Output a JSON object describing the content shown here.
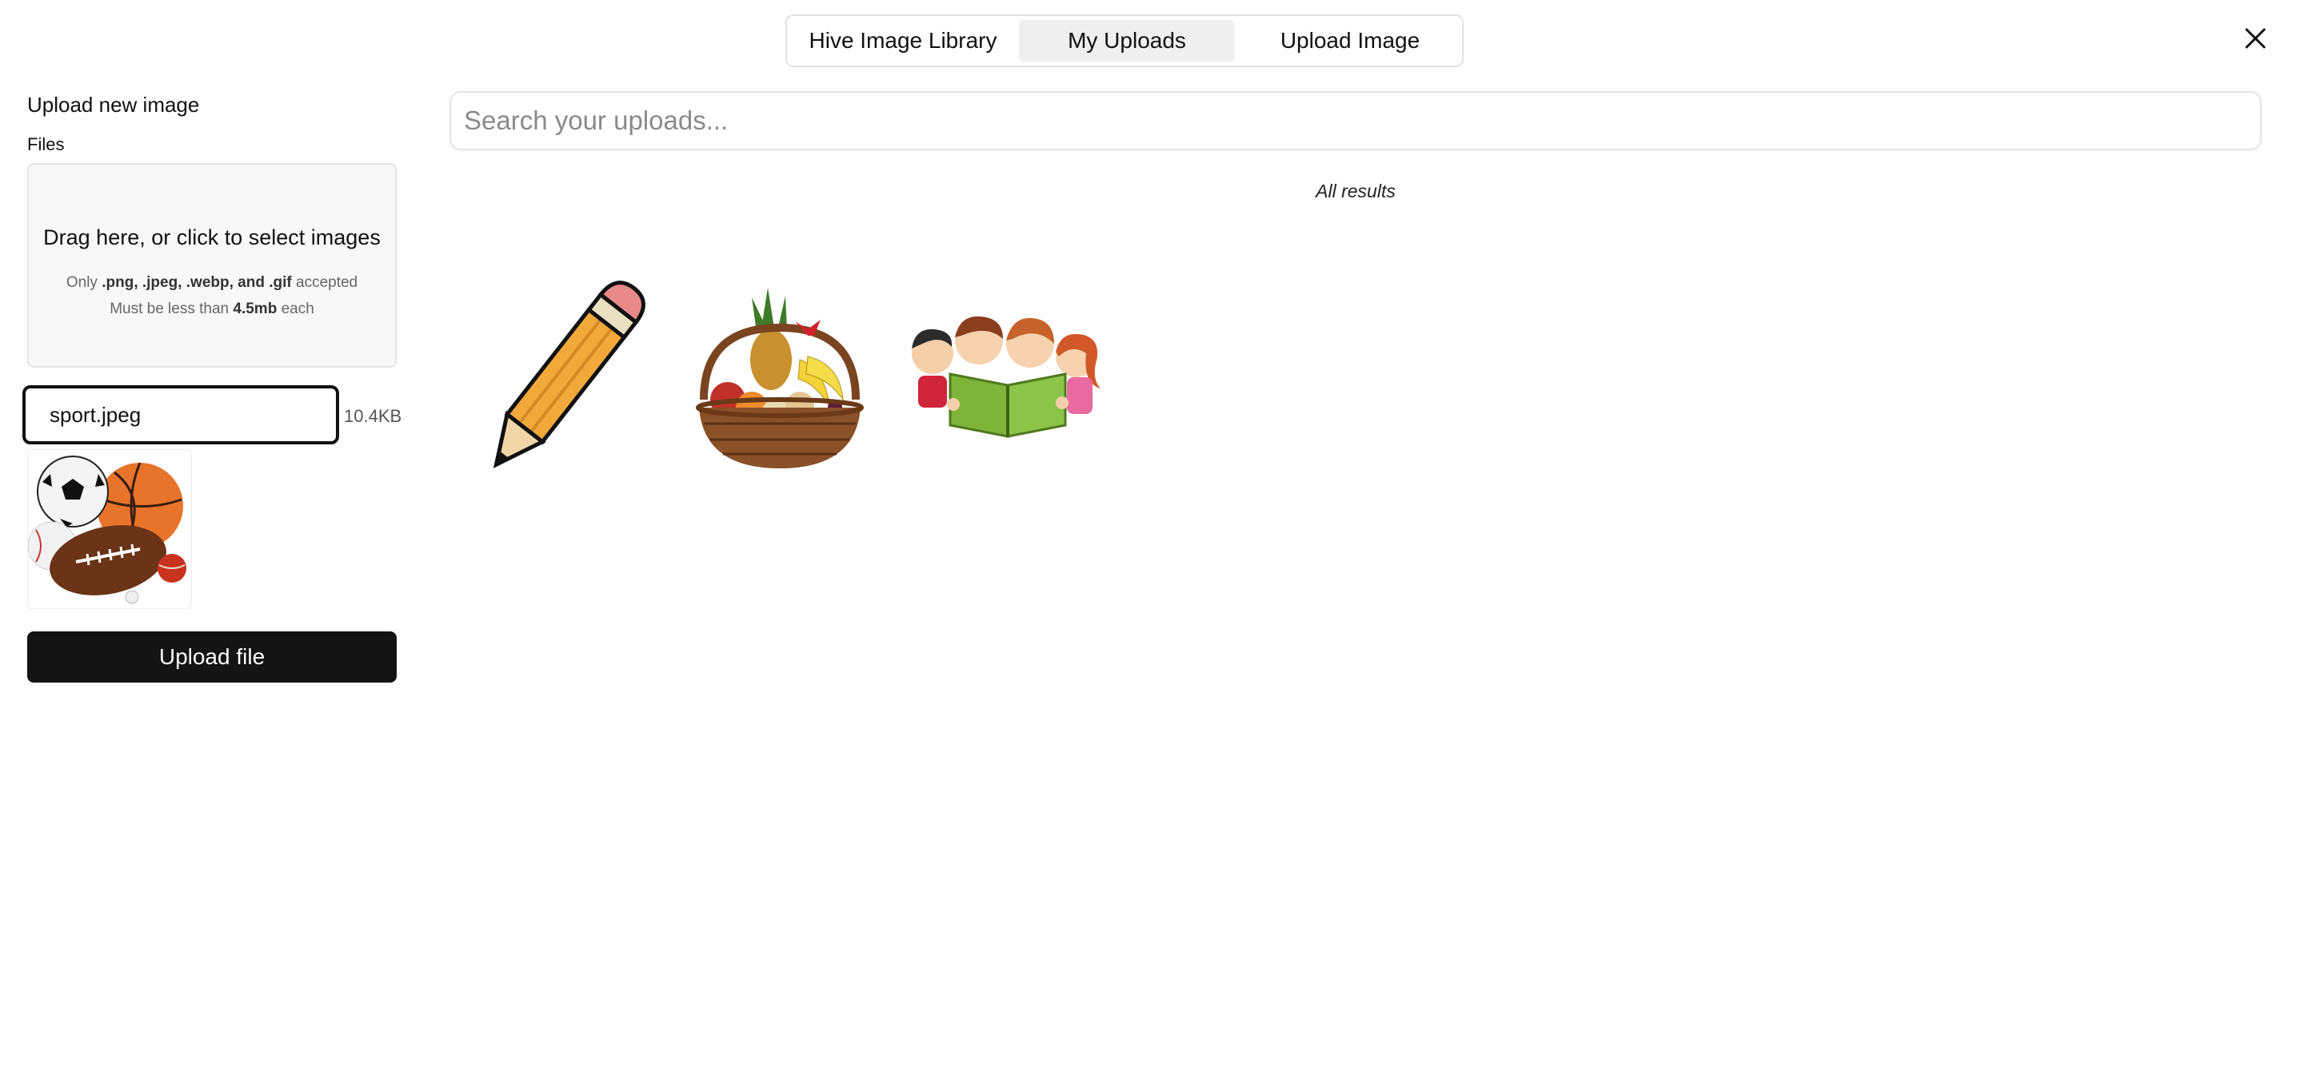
{
  "tabs": [
    {
      "label": "Hive Image Library"
    },
    {
      "label": "My Uploads",
      "active": true
    },
    {
      "label": "Upload Image"
    }
  ],
  "close_icon": "close-icon",
  "sidebar": {
    "heading": "Upload new image",
    "files_label": "Files",
    "dropzone": {
      "title": "Drag here, or click to select images",
      "accept_prefix": "Only",
      "accept_types": ".png, .jpeg, .webp, and .gif",
      "accept_suffix": "accepted",
      "size_prefix": "Must be less than",
      "size_limit": "4.5mb",
      "size_suffix": "each"
    },
    "file": {
      "name": "sport.jpeg",
      "size": "10.4KB",
      "thumbnail_icon": "sports-balls-image"
    },
    "upload_button": "Upload file"
  },
  "main": {
    "search_placeholder": "Search your uploads...",
    "results_label": "All results",
    "results": [
      {
        "icon": "pencil-image"
      },
      {
        "icon": "fruit-basket-image"
      },
      {
        "icon": "children-reading-image"
      }
    ]
  },
  "colors": {
    "button_bg": "#141414",
    "active_tab_bg": "#efefef",
    "dropzone_bg": "#f8f8f8"
  }
}
